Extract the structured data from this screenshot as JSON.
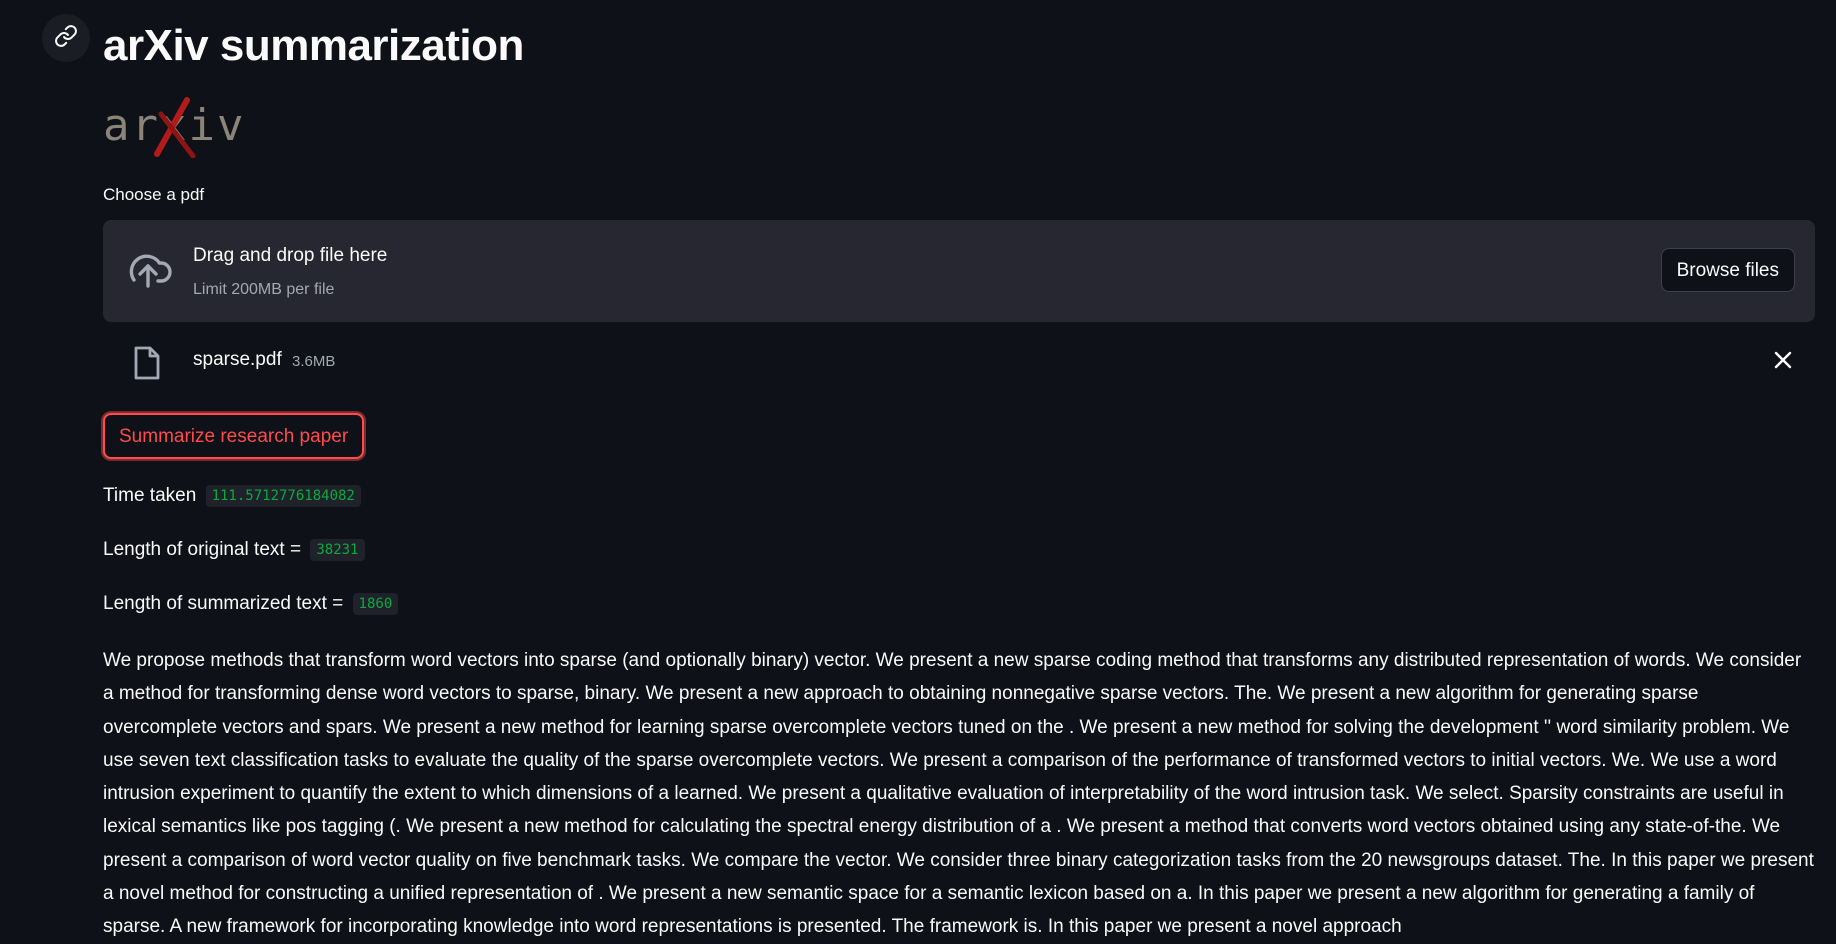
{
  "page": {
    "title": "arXiv summarization",
    "logo_text": "arxiv",
    "accent_color": "#ff4b4b",
    "code_color": "#09ab3b"
  },
  "uploader": {
    "label": "Choose a pdf",
    "drag_text": "Drag and drop file here",
    "limit_text": "Limit 200MB per file",
    "browse_label": "Browse files"
  },
  "file": {
    "name": "sparse.pdf",
    "size": "3.6MB"
  },
  "actions": {
    "summarize_label": "Summarize research paper"
  },
  "results": {
    "time_label": "Time taken",
    "time_value": "111.5712776184082",
    "original_label": "Length of original text =",
    "original_value": "38231",
    "summary_label": "Length of summarized text =",
    "summary_value": "1860"
  },
  "summary_text": "We propose methods that transform word vectors into sparse (and optionally binary) vector. We present a new sparse coding method that transforms any distributed representation of words. We consider a method for transforming dense word vectors to sparse, binary. We present a new approach to obtaining nonnegative sparse vectors. The. We present a new algorithm for generating sparse overcomplete vectors and spars. We present a new method for learning sparse overcomplete vectors tuned on the . We present a new method for solving the development '' word similarity problem. We use seven text classification tasks to evaluate the quality of the sparse overcomplete vectors. We present a comparison of the performance of transformed vectors to initial vectors. We. We use a word intrusion experiment to quantify the extent to which dimensions of a learned. We present a qualitative evaluation of interpretability of the word intrusion task. We select. Sparsity constraints are useful in lexical semantics like pos tagging (. We present a new method for calculating the spectral energy distribution of a . We present a method that converts word vectors obtained using any state-of-the. We present a comparison of word vector quality on five benchmark tasks. We compare the vector. We consider three binary categorization tasks from the 20 newsgroups dataset. The. In this paper we present a novel method for constructing a unified representation of . We present a new semantic space for a semantic lexicon based on a. In this paper we present a new algorithm for generating a family of sparse. A new framework for incorporating knowledge into word representations is presented. The framework is. In this paper we present a novel approach"
}
